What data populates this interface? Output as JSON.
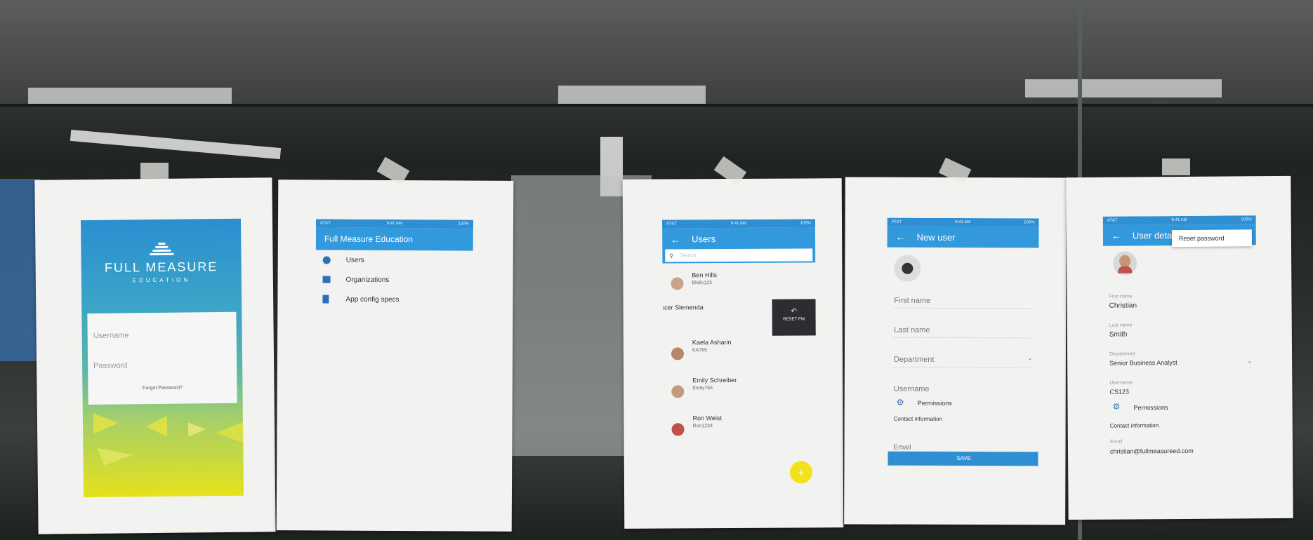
{
  "login": {
    "brand_line1": "FULL MEASURE",
    "brand_line2": "EDUCATION",
    "username_placeholder": "Username",
    "password_placeholder": "Password",
    "forgot_password": "Forgot Password?"
  },
  "menu": {
    "status_carrier": "AT&T",
    "status_time": "9:41 AM",
    "status_battery": "100%",
    "title": "Full Measure Education",
    "items": [
      {
        "label": "Users",
        "icon": "account-circle-icon"
      },
      {
        "label": "Organizations",
        "icon": "building-icon"
      },
      {
        "label": "App config specs",
        "icon": "document-icon"
      }
    ]
  },
  "users": {
    "status_carrier": "AT&T",
    "status_time": "9:41 AM",
    "status_battery": "100%",
    "title": "Users",
    "search_placeholder": "Search",
    "rows": [
      {
        "name": "Ben Hills",
        "username": "Bhills123"
      },
      {
        "name": "ıcer Slemenda",
        "username": ""
      },
      {
        "name": "Kaela Asharin",
        "username": "KA765"
      },
      {
        "name": "Emily Schreiber",
        "username": "Emily765"
      },
      {
        "name": "Ron Weist",
        "username": "Ron1234"
      }
    ],
    "reset_pw_label": "RESET PW",
    "fab_label": "+"
  },
  "new_user": {
    "status_carrier": "AT&T",
    "status_time": "9:41 AM",
    "status_battery": "100%",
    "title": "New user",
    "first_name": "First name",
    "last_name": "Last name",
    "department": "Department",
    "username": "Username",
    "permissions": "Permissions",
    "contact_information": "Contact information",
    "email": "Email",
    "save": "SAVE"
  },
  "user_details": {
    "status_carrier": "AT&T",
    "status_time": "9:41 AM",
    "status_battery": "100%",
    "title": "User deta",
    "menu_reset_password": "Reset password",
    "first_name_label": "First name",
    "first_name": "Christian",
    "last_name_label": "Last name",
    "last_name": "Smith",
    "department_label": "Department",
    "department": "Senior Business Analyst",
    "username_label": "Username",
    "username": "CS123",
    "permissions": "Permissions",
    "contact_information": "Contact information",
    "email_label": "Email",
    "email": "christian@fullmeasureed.com"
  },
  "colors": {
    "primary": "#3399dd",
    "accent": "#f2e21c",
    "login_top": "#2b8fd0",
    "login_bottom": "#e6e21a"
  }
}
